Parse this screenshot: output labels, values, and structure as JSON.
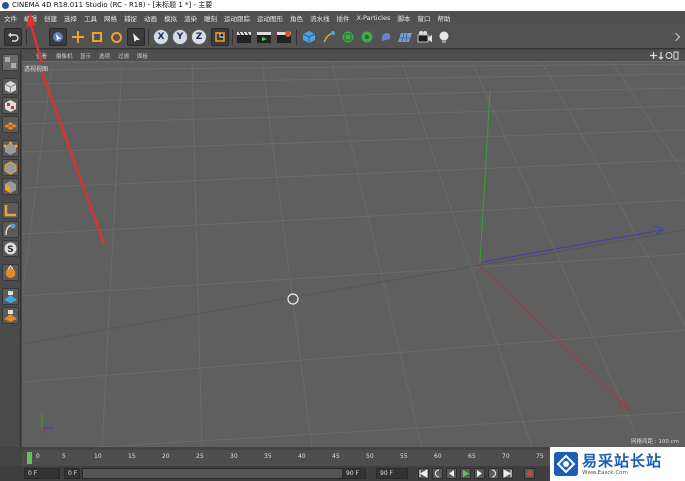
{
  "window": {
    "title": "CINEMA 4D R18.011 Studio (RC - R18) - [未标题 1 *] - 主要"
  },
  "menu": [
    "文件",
    "编辑",
    "创建",
    "选择",
    "工具",
    "网格",
    "捕捉",
    "动画",
    "模拟",
    "渲染",
    "雕刻",
    "运动跟踪",
    "运动图形",
    "角色",
    "流水线",
    "插件",
    "X-Particles",
    "脚本",
    "窗口",
    "帮助"
  ],
  "toolbar": {
    "axis_x": "X",
    "axis_y": "Y",
    "axis_z": "Z"
  },
  "viewport": {
    "menu": [
      "查看",
      "摄像机",
      "显示",
      "选项",
      "过滤",
      "面板"
    ],
    "label": "透视视图",
    "grid_spacing": "网格间距 : 100 cm"
  },
  "timeline": {
    "ticks": [
      "0",
      "5",
      "10",
      "15",
      "20",
      "25",
      "30",
      "35",
      "40",
      "45",
      "50",
      "55",
      "60",
      "65",
      "70",
      "75"
    ],
    "start_field": "0 F",
    "current_field": "0 F",
    "end_field": "90 F",
    "end_field2": "90 F"
  },
  "watermark": {
    "title": "易采站长站",
    "url": "Www.Easck.Com"
  },
  "colors": {
    "annotation_arrow": "#e03030",
    "x_axis": "#3f3fb8",
    "y_axis": "#2fa82f",
    "z_axis": "#a03a3a",
    "playhead": "#5fc35f"
  }
}
